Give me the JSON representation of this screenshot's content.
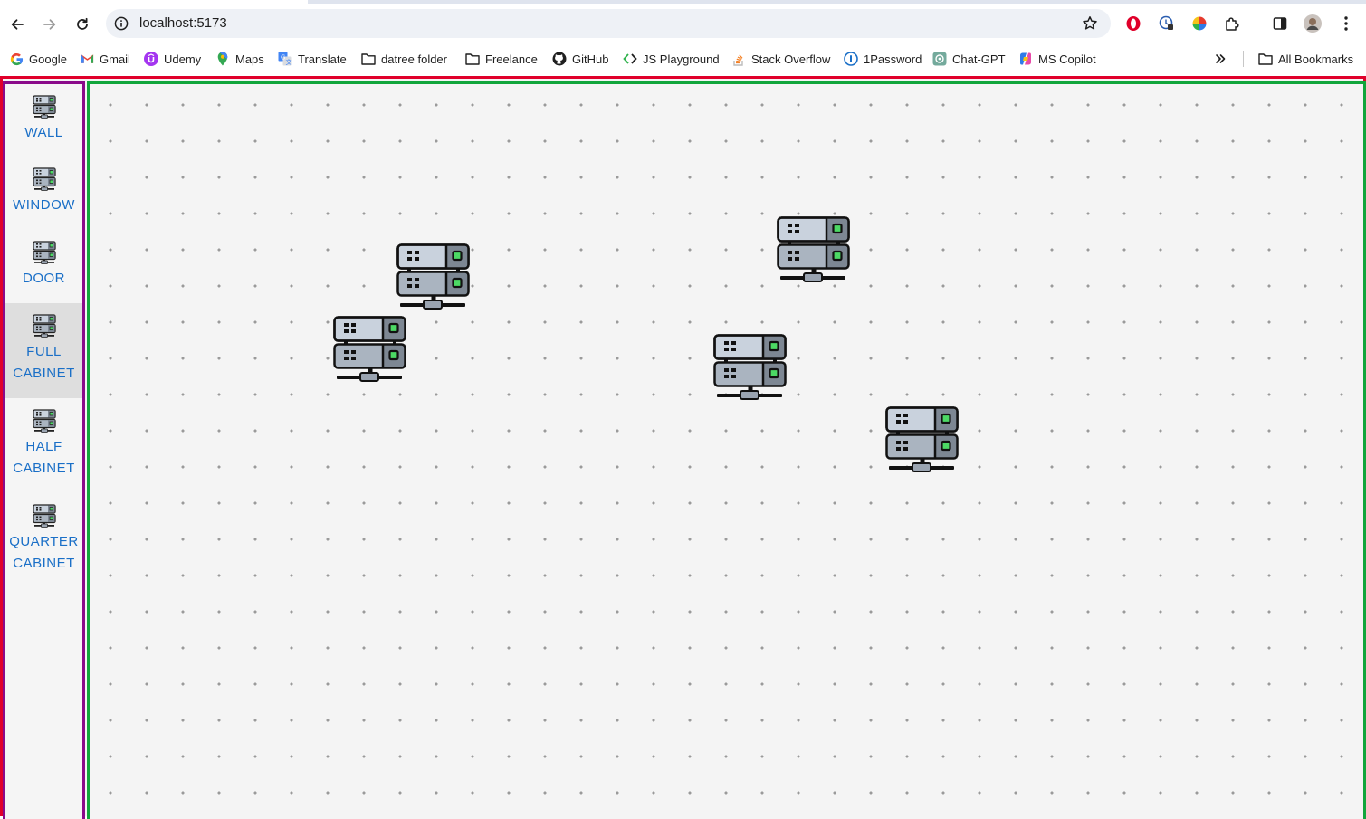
{
  "browser": {
    "url": "localhost:5173",
    "bookmarks": [
      {
        "label": "Google",
        "icon": "google-icon"
      },
      {
        "label": "Gmail",
        "icon": "gmail-icon"
      },
      {
        "label": "Udemy",
        "icon": "udemy-icon"
      },
      {
        "label": "Maps",
        "icon": "maps-icon"
      },
      {
        "label": "Translate",
        "icon": "translate-icon"
      },
      {
        "label": "datree folder",
        "icon": "folder-icon"
      },
      {
        "label": "Freelance",
        "icon": "folder-icon"
      },
      {
        "label": "GitHub",
        "icon": "github-icon"
      },
      {
        "label": "JS Playground",
        "icon": "js-playground-icon"
      },
      {
        "label": "Stack Overflow",
        "icon": "stackoverflow-icon"
      },
      {
        "label": "1Password",
        "icon": "onepassword-icon"
      },
      {
        "label": "Chat-GPT",
        "icon": "chatgpt-icon"
      },
      {
        "label": "MS Copilot",
        "icon": "copilot-icon"
      }
    ],
    "all_bookmarks_label": "All Bookmarks"
  },
  "sidebar": {
    "tools": [
      {
        "label": "WALL",
        "active": false
      },
      {
        "label": "WINDOW",
        "active": false
      },
      {
        "label": "DOOR",
        "active": false
      },
      {
        "label": "FULL CABINET",
        "active": true
      },
      {
        "label": "HALF CABINET",
        "active": false
      },
      {
        "label": "QUARTER CABINET",
        "active": false
      }
    ]
  },
  "canvas": {
    "placed_items": [
      "server-rack",
      "server-rack",
      "server-rack",
      "server-rack",
      "server-rack"
    ]
  },
  "colors": {
    "frame_border": "#e0002a",
    "sidebar_border": "#8a0a8a",
    "canvas_border": "#11a53b",
    "tool_label": "#1a6fc7",
    "server_led": "#4cd964"
  }
}
